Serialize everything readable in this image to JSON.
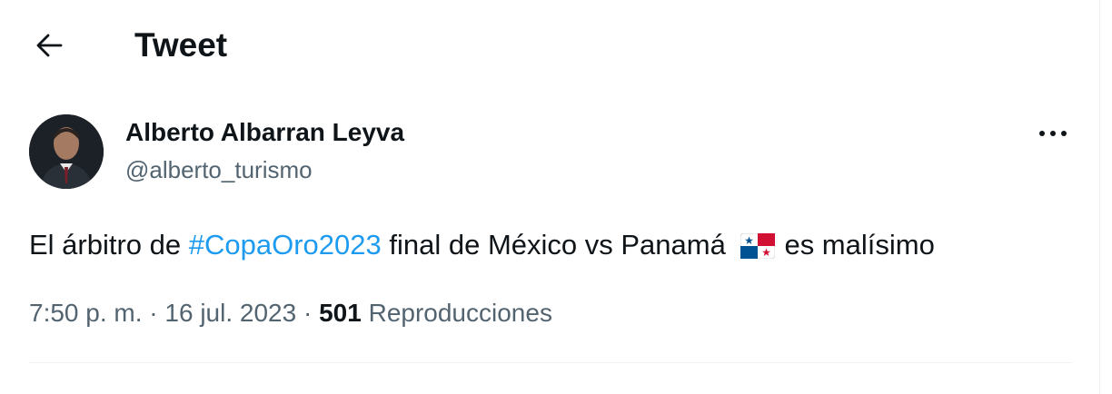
{
  "header": {
    "title": "Tweet",
    "back_icon": "arrow-left-icon"
  },
  "tweet": {
    "author_name": "Alberto Albarran Leyva",
    "author_handle": "@alberto_turismo",
    "more_icon": "more-options-icon",
    "text_before": "El árbitro de ",
    "hashtag": "#CopaOro2023",
    "text_middle": " final de México vs Panamá ",
    "flag_icon": "panama-flag-icon",
    "text_after": "es malísimo",
    "time": "7:50 p. m.",
    "sep1": "·",
    "date": "16 jul. 2023",
    "sep2": "·",
    "views_count": "501",
    "views_label": "Reproducciones"
  },
  "colors": {
    "link": "#1d9bf0",
    "secondary_text": "#536471",
    "primary_text": "#0f1419"
  }
}
